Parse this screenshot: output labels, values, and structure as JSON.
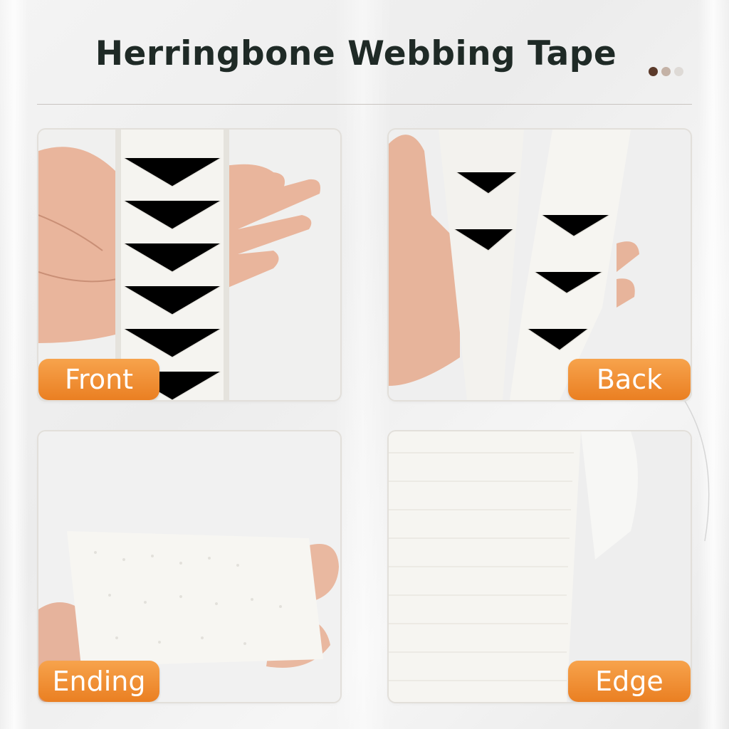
{
  "title": "Herringbone Webbing Tape",
  "carousel": {
    "dot_colors": [
      "#5b3a2a",
      "#c4b2a6",
      "#dedad6"
    ]
  },
  "panels": [
    {
      "label": "Front"
    },
    {
      "label": "Back"
    },
    {
      "label": "Ending"
    },
    {
      "label": "Edge"
    }
  ],
  "colors": {
    "badge": "#ef8a2a",
    "title": "#1f2a26",
    "tape": "#f4f3ef",
    "skin": "#e8b8a2"
  }
}
